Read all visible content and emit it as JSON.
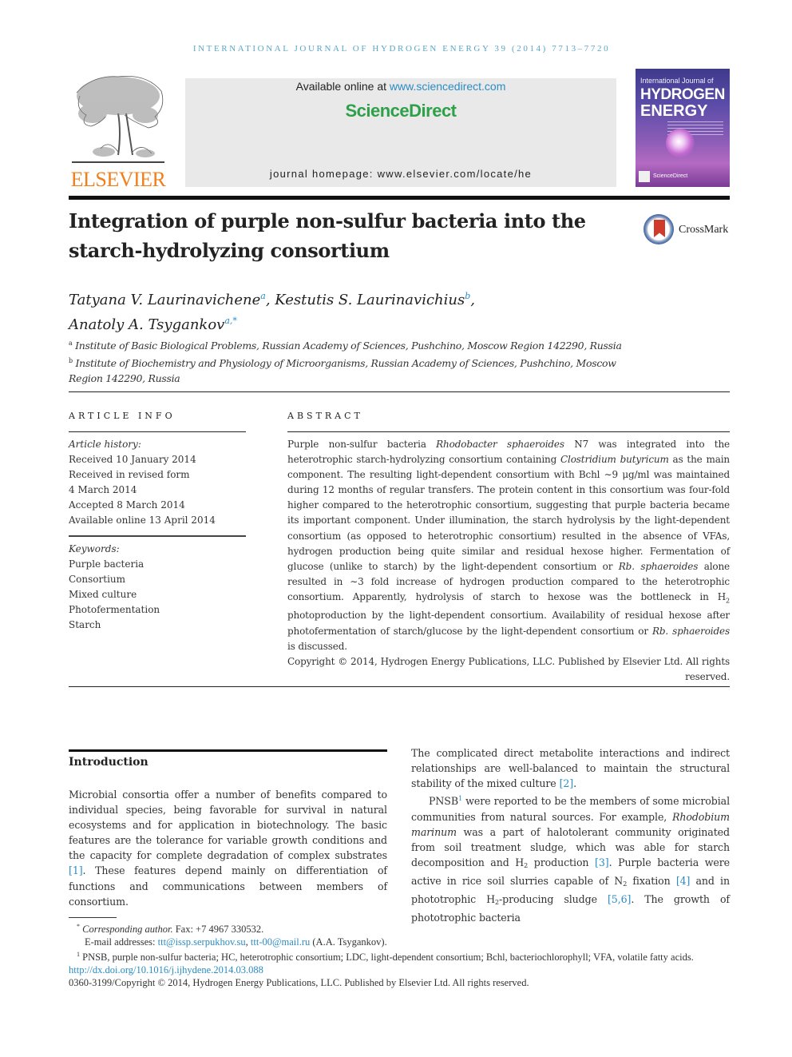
{
  "journal_header": "International Journal of Hydrogen Energy 39 (2014) 7713–7720",
  "publisher": {
    "logo_name": "ELSEVIER",
    "available_online_prefix": "Available online at ",
    "available_online_link": "www.sciencedirect.com",
    "brand": "ScienceDirect",
    "homepage_prefix": "journal homepage: ",
    "homepage_link": "www.elsevier.com/locate/he"
  },
  "cover": {
    "line1": "International Journal of",
    "line2": "HYDROGEN",
    "line3": "ENERGY",
    "footer": "ScienceDirect"
  },
  "crossmark_label": "CrossMark",
  "article": {
    "title": "Integration of purple non-sulfur bacteria into the starch-hydrolyzing consortium",
    "authors": [
      {
        "name": "Tatyana V. Laurinavichene",
        "sup": "a",
        "sep": ", "
      },
      {
        "name": "Kestutis S. Laurinavichius",
        "sup": "b",
        "sep": ","
      },
      {
        "name": "Anatoly A. Tsygankov",
        "sup": "a,*",
        "sep": ""
      }
    ],
    "affiliations": [
      {
        "key": "a",
        "text": "Institute of Basic Biological Problems, Russian Academy of Sciences, Pushchino, Moscow Region 142290, Russia"
      },
      {
        "key": "b",
        "text": "Institute of Biochemistry and Physiology of Microorganisms, Russian Academy of Sciences, Pushchino, Moscow Region 142290, Russia"
      }
    ]
  },
  "article_info": {
    "heading": "ARTICLE INFO",
    "history_label": "Article history:",
    "history": [
      "Received 10 January 2014",
      "Received in revised form",
      "4 March 2014",
      "Accepted 8 March 2014",
      "Available online 13 April 2014"
    ],
    "keywords_label": "Keywords:",
    "keywords": [
      "Purple bacteria",
      "Consortium",
      "Mixed culture",
      "Photofermentation",
      "Starch"
    ]
  },
  "abstract": {
    "heading": "ABSTRACT",
    "parts": {
      "p1": "Purple non-sulfur bacteria ",
      "i1": "Rhodobacter sphaeroides",
      "p2": " N7 was integrated into the heterotrophic starch-hydrolyzing consortium containing ",
      "i2": "Clostridium butyricum",
      "p3": " as the main component. The resulting light-dependent consortium with Bchl ∼9 μg/ml was maintained during 12 months of regular transfers. The protein content in this consortium was four-fold higher compared to the heterotrophic consortium, suggesting that purple bacteria became its important component. Under illumination, the starch hydrolysis by the light-dependent consortium (as opposed to heterotrophic consortium) resulted in the absence of VFAs, hydrogen production being quite similar and residual hexose higher. Fermentation of glucose (unlike to starch) by the light-dependent consortium or ",
      "i3": "Rb. sphaeroides",
      "p4": " alone resulted in ∼3 fold increase of hydrogen production compared to the heterotrophic consortium. Apparently, hydrolysis of starch to hexose was the bottleneck in H",
      "sub1": "2",
      "p5": " photoproduction by the light-dependent consortium. Availability of residual hexose after photofermentation of starch/glucose by the light-dependent consortium or ",
      "i4": "Rb. sphaeroides",
      "p6": " is discussed."
    },
    "copyright": "Copyright © 2014, Hydrogen Energy Publications, LLC. Published by Elsevier Ltd. All rights reserved."
  },
  "introduction": {
    "heading": "Introduction",
    "left": {
      "t1": "Microbial consortia offer a number of benefits compared to individual species, being favorable for survival in natural ecosystems and for application in biotechnology. The basic features are the tolerance for variable growth conditions and the capacity for complete degradation of complex substrates ",
      "ref1": "[1]",
      "t2": ". These features depend mainly on differentiation of functions and communications between members of consortium."
    },
    "right": {
      "a1": "The complicated direct metabolite interactions and indirect relationships are well-balanced to maintain the structural stability of the mixed culture ",
      "ref2": "[2]",
      "a2": ".",
      "b1": "PNSB",
      "b1sup": "1",
      "b2": " were reported to be the members of some microbial communities from natural sources. For example, ",
      "bi1": "Rhodobium marinum",
      "b3": " was a part of halotolerant community originated from soil treatment sludge, which was able for starch decomposition and H",
      "bsub1": "2",
      "b4": " production ",
      "ref3": "[3]",
      "b5": ". Purple bacteria were active in rice soil slurries capable of N",
      "bsub2": "2",
      "b6": " fixation ",
      "ref4": "[4]",
      "b7": " and in phototrophic H",
      "bsub3": "2",
      "b8": "-producing sludge ",
      "ref5": "[5,6]",
      "b9": ". The growth of phototrophic bacteria"
    }
  },
  "footnotes": {
    "corr_mark": "*",
    "corr_label": "Corresponding author.",
    "corr_fax": " Fax: +7 4967 330532.",
    "email_label": "E-mail addresses: ",
    "email1": "ttt@issp.serpukhov.su",
    "email_sep": ", ",
    "email2": "ttt-00@mail.ru",
    "email_owner": " (A.A. Tsygankov).",
    "abbr_mark": "1",
    "abbr_text": " PNSB, purple non-sulfur bacteria; HC, heterotrophic consortium; LDC, light-dependent consortium; Bchl, bacteriochlorophyll; VFA, volatile fatty acids.",
    "doi": "http://dx.doi.org/10.1016/j.ijhydene.2014.03.088",
    "issn_copyright": "0360-3199/Copyright © 2014, Hydrogen Energy Publications, LLC. Published by Elsevier Ltd. All rights reserved."
  }
}
